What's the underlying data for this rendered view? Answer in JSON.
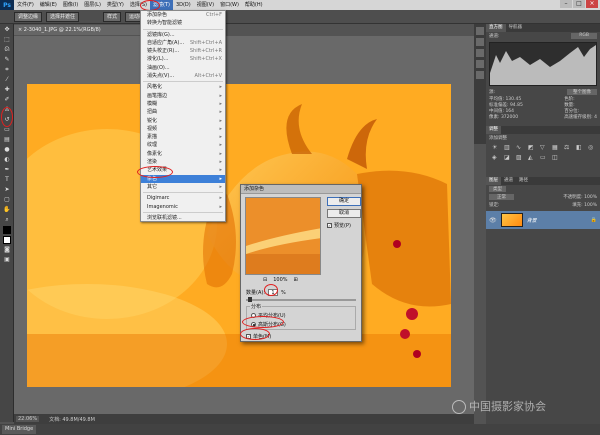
{
  "menubar": {
    "logo": "Ps",
    "items": [
      "文件(F)",
      "编辑(E)",
      "图像(I)",
      "图层(L)",
      "类型(Y)",
      "选择(S)",
      "滤镜(T)",
      "3D(D)",
      "视图(V)",
      "窗口(W)",
      "帮助(H)"
    ]
  },
  "options": {
    "btn1": "调整边缘",
    "btn2": "选择并遮住",
    "btn3": "样式",
    "btn4": "运动模糊"
  },
  "doc": {
    "tab": "×  2-3040_1.JPG @ 22.1%(RGB/8)",
    "zoom": "22.06%",
    "size": "文档: 49.8M/49.8M"
  },
  "bottom_tab": "Mini Bridge",
  "filter_menu": {
    "items": [
      {
        "label": "添加杂色",
        "shortcut": "Ctrl+F",
        "disabled": false
      },
      {
        "label": "转换为智能滤镜",
        "shortcut": "",
        "disabled": false
      },
      {
        "label": "滤镜库(G)...",
        "shortcut": "",
        "disabled": false
      },
      {
        "label": "自适应广角(A)...",
        "shortcut": "Shift+Ctrl+A",
        "disabled": false
      },
      {
        "label": "镜头校正(R)...",
        "shortcut": "Shift+Ctrl+R",
        "disabled": false
      },
      {
        "label": "液化(L)...",
        "shortcut": "Shift+Ctrl+X",
        "disabled": false
      },
      {
        "label": "油画(O)...",
        "shortcut": "",
        "disabled": false
      },
      {
        "label": "消失点(V)...",
        "shortcut": "Alt+Ctrl+V",
        "disabled": false
      },
      {
        "label": "风格化",
        "shortcut": "▸",
        "disabled": false
      },
      {
        "label": "画笔描边",
        "shortcut": "▸",
        "disabled": false
      },
      {
        "label": "模糊",
        "shortcut": "▸",
        "disabled": false
      },
      {
        "label": "扭曲",
        "shortcut": "▸",
        "disabled": false
      },
      {
        "label": "锐化",
        "shortcut": "▸",
        "disabled": false
      },
      {
        "label": "视频",
        "shortcut": "▸",
        "disabled": false
      },
      {
        "label": "素描",
        "shortcut": "▸",
        "disabled": false
      },
      {
        "label": "纹理",
        "shortcut": "▸",
        "disabled": false
      },
      {
        "label": "像素化",
        "shortcut": "▸",
        "disabled": false
      },
      {
        "label": "渲染",
        "shortcut": "▸",
        "disabled": false
      },
      {
        "label": "艺术效果",
        "shortcut": "▸",
        "disabled": false
      },
      {
        "label": "杂色",
        "shortcut": "▸",
        "disabled": false
      },
      {
        "label": "其它",
        "shortcut": "▸",
        "disabled": false
      },
      {
        "label": "Digimarc",
        "shortcut": "▸",
        "disabled": false
      },
      {
        "label": "Imagenomic",
        "shortcut": "▸",
        "disabled": false
      },
      {
        "label": "浏览联机滤镜...",
        "shortcut": "",
        "disabled": false
      }
    ]
  },
  "dialog": {
    "title": "添加杂色",
    "ok": "确定",
    "cancel": "取消",
    "preview_label": "预览(P)",
    "zoom": "100%",
    "amount_label": "数量(A):",
    "amount_value": "1",
    "amount_unit": "%",
    "distribution_label": "分布",
    "uniform": "平均分布(U)",
    "gaussian": "高斯分布(G)",
    "mono": "单色(M)",
    "amount_fraction": 0.02
  },
  "panels": {
    "histogram_tabs": [
      "直方图",
      "导航器"
    ],
    "channel_label": "通道:",
    "channel_value": "RGB",
    "source_label": "源:",
    "source_value": "整个图像",
    "stats_left": [
      "平均值: 130.45",
      "标准偏差: 94.85",
      "中间值: 164",
      "像素: 372000"
    ],
    "stats_right": [
      "色阶:",
      "数量:",
      "百分位:",
      "高速缓存级别: 4"
    ],
    "adjust_tab": "调整",
    "adjust_title": "添加调整",
    "layers_tabs": [
      "图层",
      "通道",
      "路径"
    ],
    "layer_kind": "类型",
    "blend_mode": "正常",
    "opacity": "不透明度: 100%",
    "lock": "锁定:",
    "fill": "填充: 100%",
    "layer_name": "背景"
  },
  "watermark": "中国摄影家协会"
}
